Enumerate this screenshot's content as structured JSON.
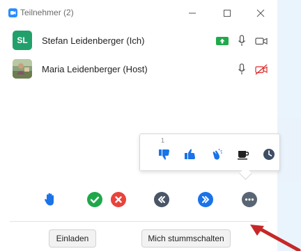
{
  "window": {
    "title": "Teilnehmer (2)",
    "accent": "#2d8cff"
  },
  "participants": [
    {
      "initials": "SL",
      "name": "Stefan Leidenberger (Ich)",
      "avatar_color": "#22a06b",
      "icons": [
        "share-screen-icon",
        "microphone-icon",
        "video-camera-icon"
      ]
    },
    {
      "initials": "",
      "name": "Maria Leidenberger (Host)",
      "avatar_color": "",
      "icons": [
        "microphone-icon",
        "video-off-icon"
      ]
    }
  ],
  "reactions_popup": {
    "count": "1",
    "items": [
      "thumbs-down-icon",
      "thumbs-up-icon",
      "clap-icon",
      "coffee-icon",
      "clock-icon"
    ]
  },
  "feedback_bar": [
    "raise-hand-icon",
    "yes-icon",
    "no-icon",
    "slower-icon",
    "faster-icon",
    "more-icon"
  ],
  "footer": {
    "invite_label": "Einladen",
    "mute_label": "Mich stummschalten"
  }
}
